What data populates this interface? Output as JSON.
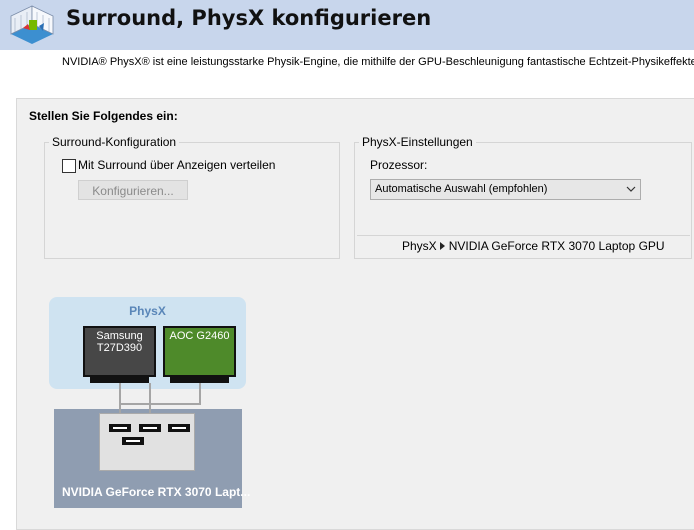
{
  "header": {
    "title": "Surround, PhysX konfigurieren",
    "icon": "nvidia-control-panel-icon"
  },
  "description": "NVIDIA® PhysX® ist eine leistungsstarke Physik-Engine, die mithilfe der GPU-Beschleunigung fantastische Echtzeit-Physikeffekte biete",
  "instruction": "Stellen Sie Folgendes ein:",
  "surround": {
    "group_label": "Surround-Konfiguration",
    "checkbox_label": "Mit Surround über Anzeigen verteilen",
    "checkbox_checked": false,
    "configure_button": "Konfigurieren..."
  },
  "physx_settings": {
    "group_label": "PhysX-Einstellungen",
    "processor_label": "Prozessor:",
    "processor_value": "Automatische Auswahl (empfohlen)",
    "path_label": "PhysX",
    "path_target": "NVIDIA GeForce RTX 3070 Laptop GPU"
  },
  "diagram": {
    "physx_title": "PhysX",
    "monitors": [
      {
        "name": "Samsung T27D390",
        "line1": "Samsung",
        "line2": "T27D390",
        "color": "#474747"
      },
      {
        "name": "AOC G2460",
        "line1": "AOC G2460",
        "line2": "",
        "color": "#4e8a2a"
      }
    ],
    "gpu_name": "NVIDIA GeForce RTX 3070 Lapt..."
  },
  "colors": {
    "header_bg": "#c8d6ec",
    "panel_bg": "#f0f0f0",
    "physx_card_bg": "#cfe3f1",
    "gpu_box_bg": "#8f9db1"
  }
}
